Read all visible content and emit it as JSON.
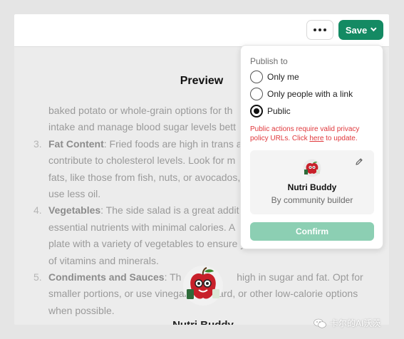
{
  "topbar": {
    "more_icon": "ellipsis-icon",
    "save_label": "Save",
    "save_color": "#148a63"
  },
  "preview": {
    "title": "Preview",
    "lines": [
      {
        "num": "",
        "bold": "",
        "text": "baked potato or whole-grain options for th"
      },
      {
        "num": "",
        "bold": "",
        "text": "intake and manage blood sugar levels bett"
      },
      {
        "num": "3.",
        "bold": "Fat Content",
        "text": ": Fried foods are high in trans a"
      },
      {
        "num": "",
        "bold": "",
        "text": "contribute to cholesterol levels. Look for m"
      },
      {
        "num": "",
        "bold": "",
        "text": "fats, like those from fish, nuts, or avocados,"
      },
      {
        "num": "",
        "bold": "",
        "text": "use less oil."
      },
      {
        "num": "4.",
        "bold": "Vegetables",
        "text": ": The side salad is a great addit"
      },
      {
        "num": "",
        "bold": "",
        "text": "essential nutrients with minimal calories. A"
      },
      {
        "num": "",
        "bold": "",
        "text": "plate with a variety of vegetables to ensure you're getting a wide range"
      },
      {
        "num": "",
        "bold": "",
        "text": "of vitamins and minerals."
      },
      {
        "num": "5.",
        "bold": "Condiments and Sauces",
        "text": ": Th                    high in sugar and fat. Opt for"
      },
      {
        "num": "",
        "bold": "",
        "text": "smaller portions, or use vinegar           ard, or other low-calorie options"
      },
      {
        "num": "",
        "bold": "",
        "text": "when possible."
      }
    ],
    "gpt_name_partial": "Nutri Buddy"
  },
  "publish": {
    "heading": "Publish to",
    "options": [
      {
        "label": "Only me",
        "checked": false
      },
      {
        "label": "Only people with a link",
        "checked": false
      },
      {
        "label": "Public",
        "checked": true
      }
    ],
    "warning_before": "Public actions require valid privacy policy URLs. Click ",
    "warning_link": "here",
    "warning_after": " to update.",
    "card": {
      "name": "Nutri Buddy",
      "byline": "By community builder",
      "edit_icon": "pencil-icon"
    },
    "confirm_label": "Confirm",
    "confirm_color": "#8ccfb3"
  },
  "watermark": {
    "text": "卡尔的AI沃茨"
  }
}
